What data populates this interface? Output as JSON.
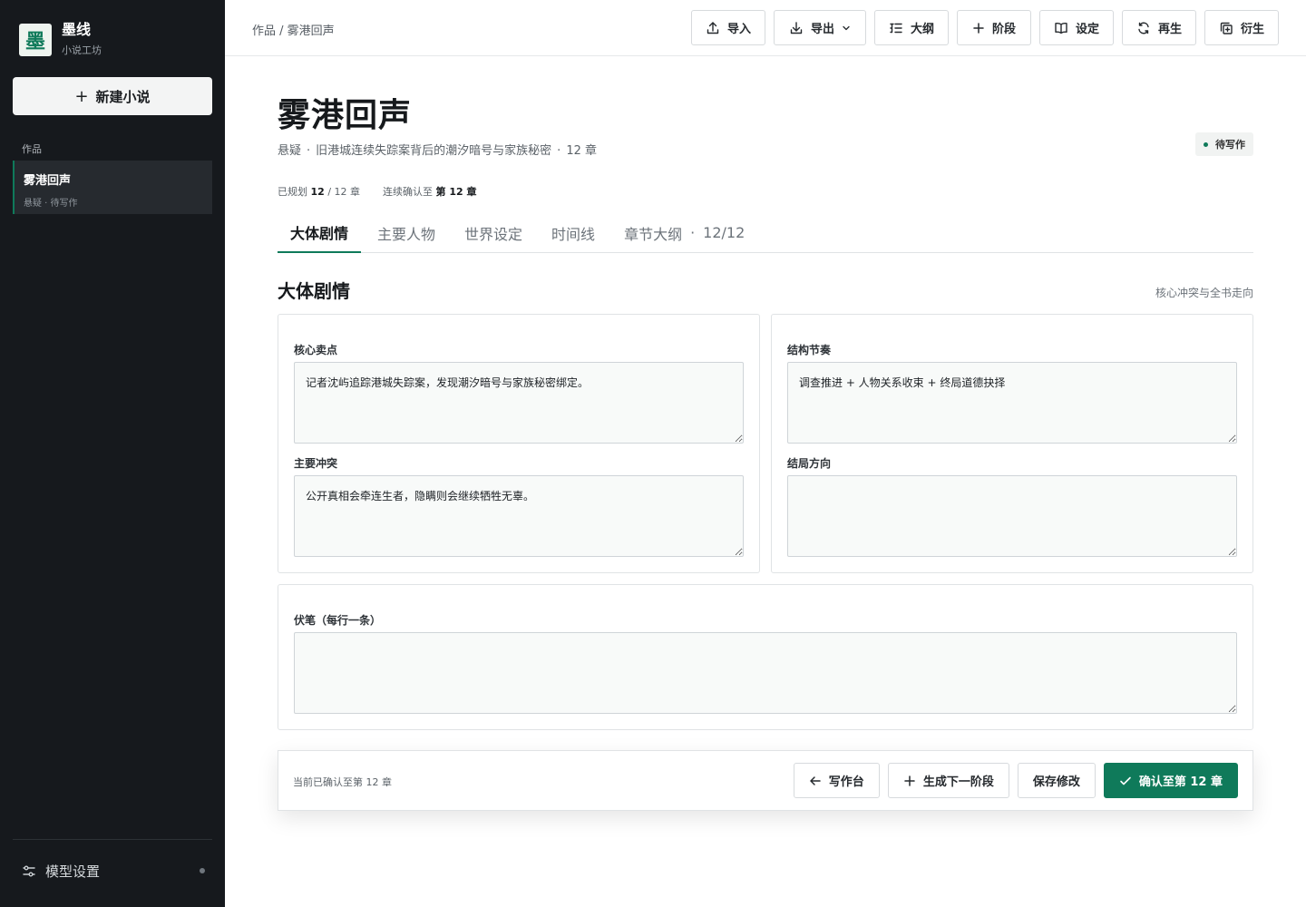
{
  "app": {
    "logo_char": "墨",
    "name": "墨线",
    "subtitle": "小说工坊"
  },
  "sidebar": {
    "new_button": "新建小说",
    "section_label": "作品",
    "works": [
      {
        "title": "雾港回声",
        "meta": "悬疑 · 待写作"
      }
    ],
    "model_settings": "模型设置"
  },
  "breadcrumb": "作品 / 雾港回声",
  "toolbar": {
    "import": "导入",
    "export": "导出",
    "outline": "大纲",
    "stage": "阶段",
    "settings": "设定",
    "regenerate": "再生",
    "derive": "衍生"
  },
  "novel": {
    "title": "雾港回声",
    "genre": "悬疑",
    "logline": "旧港城连续失踪案背后的潮汐暗号与家族秘密",
    "chapters": "12 章",
    "status": "待写作",
    "planned_label": "已规划",
    "planned_value": "12",
    "planned_total": "/ 12 章",
    "confirmed_label": "连续确认至",
    "confirmed_value": "第 12 章"
  },
  "tabs": [
    {
      "label": "大体剧情"
    },
    {
      "label": "主要人物"
    },
    {
      "label": "世界设定"
    },
    {
      "label": "时间线"
    },
    {
      "label": "章节大纲",
      "count": "12/12"
    }
  ],
  "section": {
    "title": "大体剧情",
    "hint": "核心冲突与全书走向"
  },
  "fields": {
    "core_selling_point": {
      "label": "核心卖点",
      "value": "记者沈屿追踪港城失踪案，发现潮汐暗号与家族秘密绑定。"
    },
    "structure_rhythm": {
      "label": "结构节奏",
      "value": "调查推进 + 人物关系收束 + 终局道德抉择"
    },
    "main_conflict": {
      "label": "主要冲突",
      "value": "公开真相会牵连生者，隐瞒则会继续牺牲无辜。"
    },
    "ending_direction": {
      "label": "结局方向",
      "value": ""
    },
    "foreshadowing": {
      "label": "伏笔（每行一条）",
      "value": ""
    }
  },
  "footer": {
    "status": "当前已确认至第 12 章",
    "workspace": "写作台",
    "generate_next": "生成下一阶段",
    "save": "保存修改",
    "confirm": "确认至第 12 章"
  },
  "colors": {
    "accent": "#0f7a5a",
    "sidebar_bg": "#16191d"
  }
}
